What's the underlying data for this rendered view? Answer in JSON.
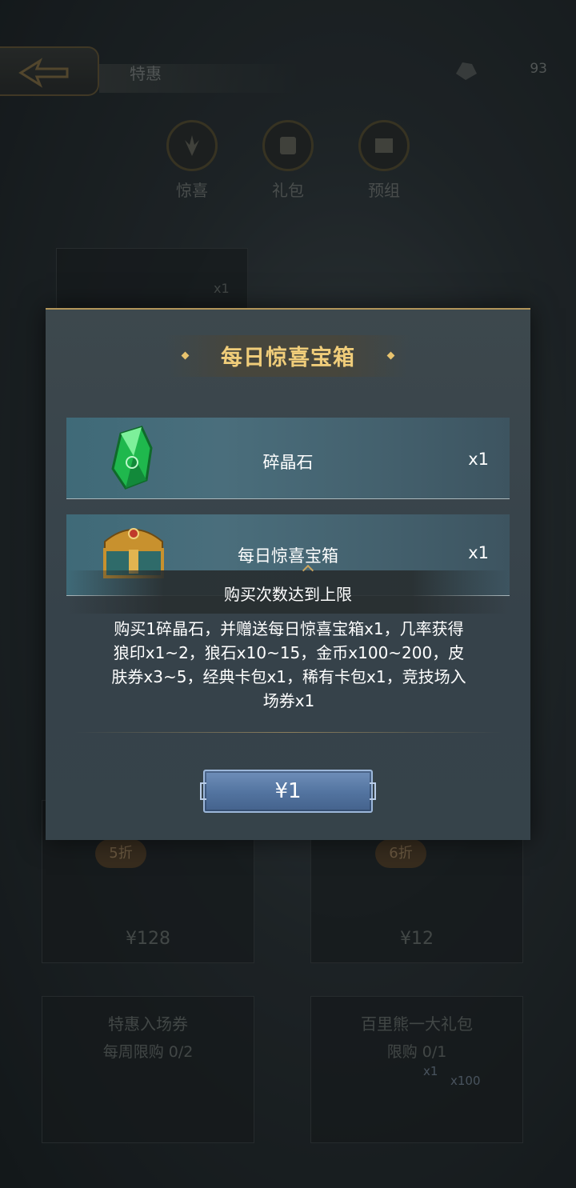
{
  "header": {
    "title": "特惠",
    "currency_value": "93"
  },
  "tabs": [
    {
      "label": "惊喜",
      "icon": "surprise-icon"
    },
    {
      "label": "礼包",
      "icon": "gift-icon"
    },
    {
      "label": "预组",
      "icon": "deck-icon"
    }
  ],
  "background_cards": [
    {
      "badge": "x1"
    },
    {
      "discount": "5折",
      "price": "¥128"
    },
    {
      "discount": "6折",
      "price": "¥12"
    },
    {
      "name": "特惠入场券",
      "limit": "每周限购 0/2"
    },
    {
      "name": "百里熊一大礼包",
      "limit": "限购 0/1",
      "badge1": "x1",
      "badge2": "x100"
    }
  ],
  "modal": {
    "title": "每日惊喜宝箱",
    "rewards": [
      {
        "name": "碎晶石",
        "qty": "x1",
        "icon": "green-crystal-icon"
      },
      {
        "name": "每日惊喜宝箱",
        "qty": "x1",
        "icon": "treasure-chest-icon"
      }
    ],
    "toast": "购买次数达到上限",
    "description": "购买1碎晶石，并赠送每日惊喜宝箱x1，几率获得狼印x1~2，狼石x10~15，金币x100~200，皮肤券x3~5，经典卡包x1，稀有卡包x1，竞技场入场券x1",
    "buy_label": "¥1"
  },
  "colors": {
    "title_gold": "#f0cd7a",
    "button_blue": "#52739f",
    "row_teal": "#4a6e7c"
  }
}
